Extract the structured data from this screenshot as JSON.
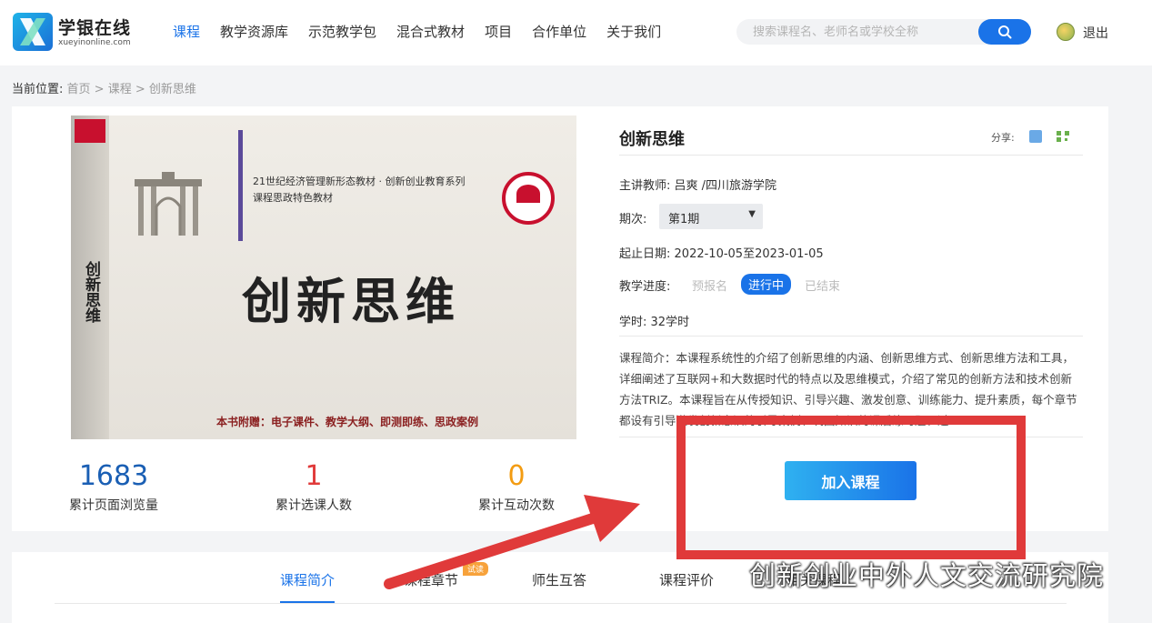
{
  "header": {
    "logo_name": "学银在线",
    "logo_url": "xueyinonline.com",
    "nav": [
      "课程",
      "教学资源库",
      "示范教学包",
      "混合式教材",
      "项目",
      "合作单位",
      "关于我们"
    ],
    "active_nav": 0,
    "search_placeholder": "搜索课程名、老师名或学校全称",
    "logout": "退出",
    "accent": "#1a73e8"
  },
  "breadcrumb": {
    "label": "当前位置:",
    "items": [
      "首页",
      "课程",
      "创新思维"
    ],
    "separator": " > "
  },
  "cover": {
    "series": "21世纪经济管理新形态教材 · 创新创业教育系列",
    "subseries": "课程思政特色教材",
    "title": "创新思维",
    "spine_title": "创新思维",
    "bottom_text": "本书附赠：电子课件、教学大纲、即测即练、思政案例"
  },
  "course": {
    "title": "创新思维",
    "share_label": "分享:",
    "teacher_label": "主讲教师:",
    "teacher": "吕爽 /四川旅游学院",
    "period_label": "期次:",
    "period_value": "第1期",
    "dates_label": "起止日期:",
    "dates": "2022-10-05至2023-01-05",
    "progress_label": "教学进度:",
    "stages": [
      "预报名",
      "进行中",
      "已结束"
    ],
    "active_stage": 1,
    "hours_label": "学时:",
    "hours": "32学时",
    "description": "课程简介：本课程系统性的介绍了创新思维的内涵、创新思维方式、创新思维方法和工具，详细阐述了互联网+和大数据时代的特点以及思维模式，介绍了常见的创新方法和技术创新方法TRIZ。本课程旨在从传授知识、引导兴趣、激发创意、训练能力、提升素质，每个章节都设有引导激发创新意识的引导案例、巩固知识的课后练习题、过..."
  },
  "stats": [
    {
      "value": "1683",
      "label": "累计页面浏览量",
      "color": "#1a5fb4"
    },
    {
      "value": "1",
      "label": "累计选课人数",
      "color": "#e03a3a"
    },
    {
      "value": "0",
      "label": "累计互动次数",
      "color": "#f39c12"
    }
  ],
  "join_button": "加入课程",
  "tabs": {
    "items": [
      "课程简介",
      "课程章节",
      "师生互答",
      "课程评价",
      "相关课程"
    ],
    "active": 0,
    "badge": "试读"
  },
  "watermark": "创新创业中外人文交流研究院",
  "annotation_color": "#e03a3a"
}
